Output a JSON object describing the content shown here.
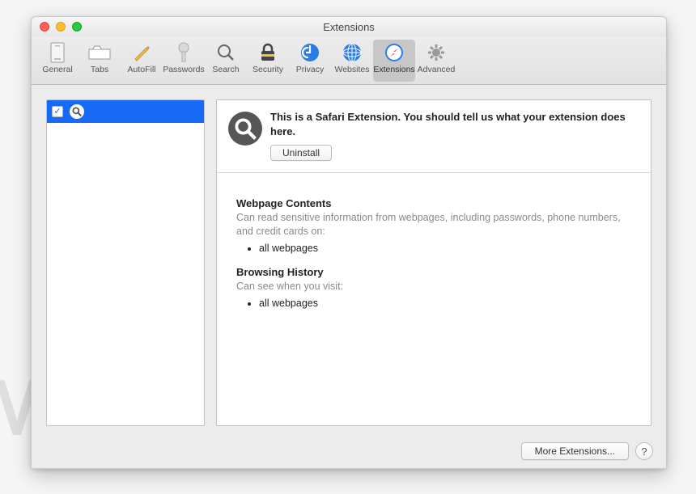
{
  "window": {
    "title": "Extensions"
  },
  "toolbar": {
    "items": [
      {
        "label": "General"
      },
      {
        "label": "Tabs"
      },
      {
        "label": "AutoFill"
      },
      {
        "label": "Passwords"
      },
      {
        "label": "Search"
      },
      {
        "label": "Security"
      },
      {
        "label": "Privacy"
      },
      {
        "label": "Websites"
      },
      {
        "label": "Extensions"
      },
      {
        "label": "Advanced"
      }
    ]
  },
  "sidebar": {
    "items": [
      {
        "checked": true,
        "name": ""
      }
    ]
  },
  "detail": {
    "description": "This is a Safari Extension. You should tell us what your extension does here.",
    "uninstall_label": "Uninstall",
    "permissions": [
      {
        "title": "Webpage Contents",
        "desc": "Can read sensitive information from webpages, including passwords, phone numbers, and credit cards on:",
        "items": [
          "all webpages"
        ]
      },
      {
        "title": "Browsing History",
        "desc": "Can see when you visit:",
        "items": [
          "all webpages"
        ]
      }
    ]
  },
  "footer": {
    "more_label": "More Extensions...",
    "help_label": "?"
  },
  "watermark": "MALWARETIPS"
}
